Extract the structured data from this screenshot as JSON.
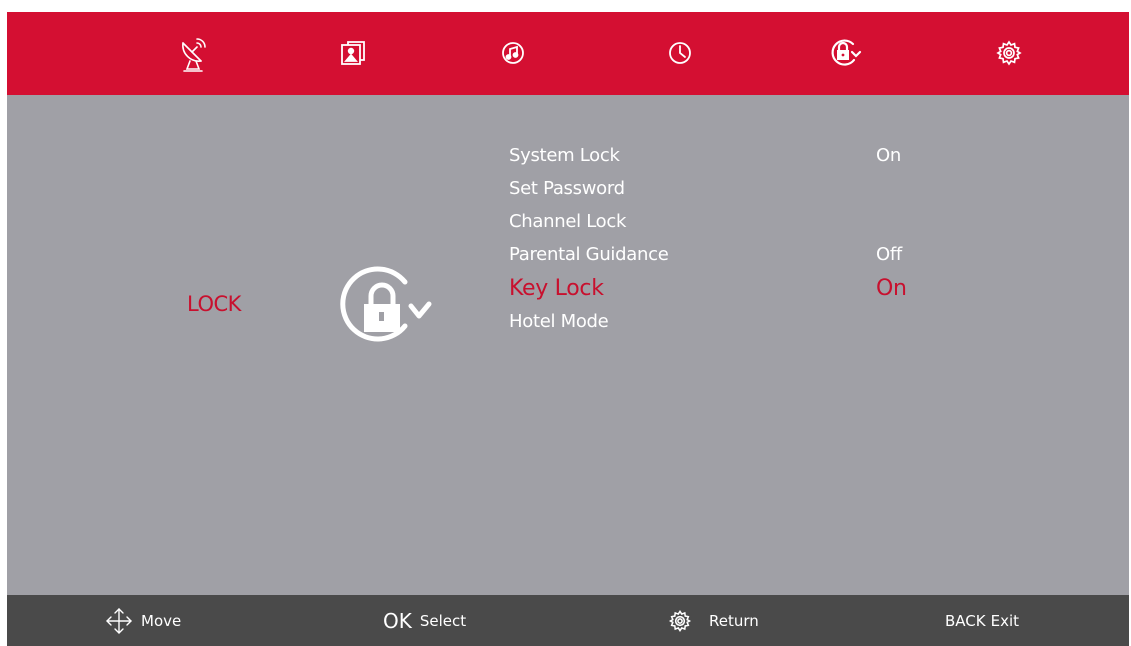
{
  "tabs": [
    {
      "icon": "satellite-icon",
      "label": "Channel"
    },
    {
      "icon": "picture-icon",
      "label": "Picture"
    },
    {
      "icon": "sound-icon",
      "label": "Sound"
    },
    {
      "icon": "clock-icon",
      "label": "Time"
    },
    {
      "icon": "lock-icon",
      "label": "Lock",
      "selected": true
    },
    {
      "icon": "gear-icon",
      "label": "Setup"
    }
  ],
  "section": {
    "title": "LOCK",
    "icon": "lock-rotate-icon"
  },
  "menu": [
    {
      "label": "System Lock",
      "value": "On",
      "selected": false
    },
    {
      "label": "Set Password",
      "value": "",
      "selected": false
    },
    {
      "label": "Channel Lock",
      "value": "",
      "selected": false
    },
    {
      "label": "Parental Guidance",
      "value": "Off",
      "selected": false
    },
    {
      "label": "Key Lock",
      "value": "On",
      "selected": true
    },
    {
      "label": "Hotel Mode",
      "value": "",
      "selected": false
    }
  ],
  "hints": {
    "move": {
      "icon": "arrows-icon",
      "label": "Move"
    },
    "select": {
      "key": "OK",
      "label": "Select"
    },
    "return": {
      "icon": "gear-icon",
      "label": "Return"
    },
    "exit": {
      "key": "BACK",
      "label": "Exit"
    }
  },
  "colors": {
    "accent": "#d40f32",
    "panel": "#a0a0a6",
    "footer": "#4a4a4a",
    "highlight": "#c8102e"
  }
}
